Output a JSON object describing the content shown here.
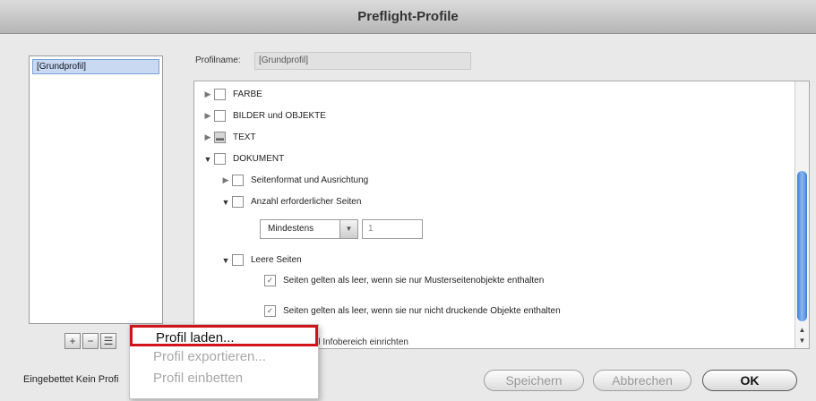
{
  "window": {
    "title": "Preflight-Profile"
  },
  "profile_list": {
    "items": [
      "[Grundprofil]"
    ]
  },
  "list_buttons": [
    "+",
    "−",
    "☰"
  ],
  "profile_name": {
    "label": "Profilname:",
    "value": "[Grundprofil]"
  },
  "tree": {
    "farbe": "FARBE",
    "bilder": "BILDER und OBJEKTE",
    "text": "TEXT",
    "dokument": "DOKUMENT",
    "seitenformat": "Seitenformat und Ausrichtung",
    "anzahl": "Anzahl erforderlicher Seiten",
    "mindestens": "Mindestens",
    "anzahl_value": "1",
    "leere_seiten": "Leere Seiten",
    "leer_option1": "Seiten gelten als leer, wenn sie nur Musterseitenobjekte enthalten",
    "leer_option2": "Seiten gelten als leer, wenn sie nur nicht druckende Objekte enthalten",
    "partial_row": "d Infobereich einrichten"
  },
  "footer": {
    "embedded_text": "Eingebettet Kein Profi"
  },
  "context_menu": {
    "items": [
      {
        "label": "Profil laden...",
        "state": "highlighted"
      },
      {
        "label": "Profil exportieren...",
        "state": "disabled"
      },
      {
        "label": "Profil einbetten",
        "state": "disabled"
      }
    ],
    "highlight_color": "#d2131a"
  },
  "buttons": {
    "save": "Speichern",
    "cancel": "Abbrechen",
    "ok": "OK"
  }
}
